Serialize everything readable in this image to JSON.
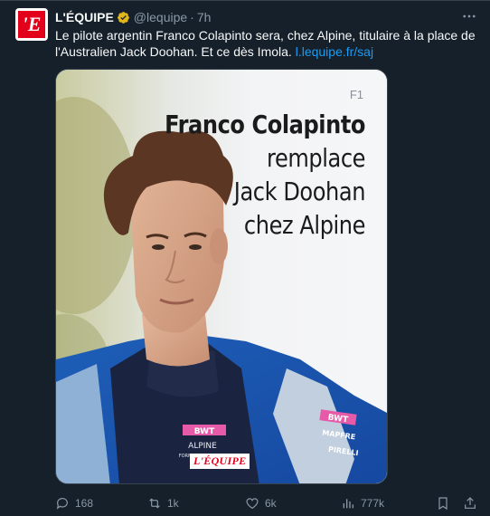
{
  "author": {
    "name": "L'ÉQUIPE",
    "handle": "@lequipe",
    "separator": "·",
    "time": "7h",
    "avatar_letter": "'E"
  },
  "tweet": {
    "text": "Le pilote argentin Franco Colapinto sera, chez Alpine, titulaire à la place de l'Australien Jack Doohan. Et ce dès Imola.",
    "link": "l.lequipe.fr/saj"
  },
  "media": {
    "tag": "F1",
    "headline_bold": "Franco Colapinto",
    "headline_lines": [
      "remplace",
      "Jack Doohan",
      "chez Alpine"
    ],
    "watermark": "L'ÉQUIPE",
    "jacket_text": [
      "BWT",
      "ALPINE",
      "FORMULA ONE TEAM",
      "BWT",
      "MAPFRE",
      "PIRELLI"
    ]
  },
  "actions": {
    "replies": "168",
    "retweets": "1k",
    "likes": "6k",
    "views": "777k"
  },
  "icons": {
    "verified": "verified-badge-icon",
    "more": "more-icon",
    "reply": "reply-icon",
    "retweet": "retweet-icon",
    "like": "heart-icon",
    "views": "views-icon",
    "bookmark": "bookmark-icon",
    "share": "share-icon"
  },
  "colors": {
    "background": "#15202b",
    "accent": "#1d9bf0",
    "verified": "#e2b719",
    "brand": "#e2001a",
    "muted": "#8b98a5"
  }
}
